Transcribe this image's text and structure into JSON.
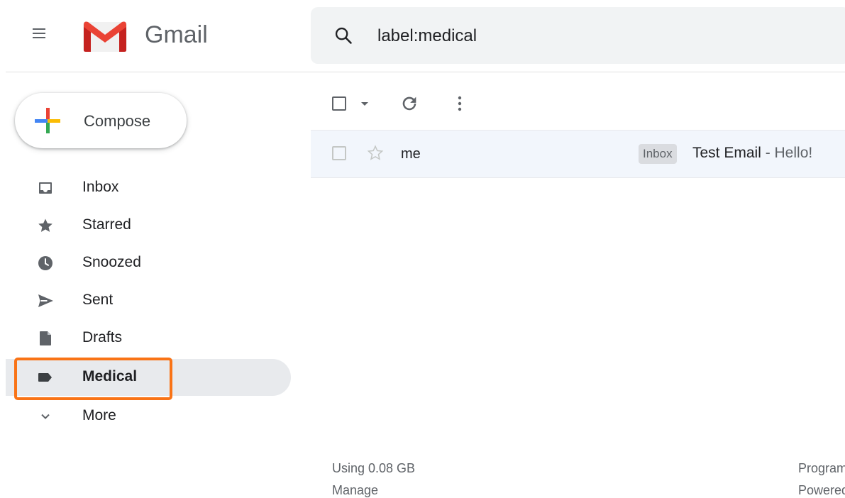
{
  "header": {
    "app_name": "Gmail",
    "search_value": "label:medical"
  },
  "compose": {
    "label": "Compose"
  },
  "sidebar": {
    "items": [
      {
        "label": "Inbox",
        "icon": "inbox-icon"
      },
      {
        "label": "Starred",
        "icon": "star-icon"
      },
      {
        "label": "Snoozed",
        "icon": "clock-icon"
      },
      {
        "label": "Sent",
        "icon": "send-icon"
      },
      {
        "label": "Drafts",
        "icon": "draft-icon"
      },
      {
        "label": "Medical",
        "icon": "label-icon",
        "active": true
      },
      {
        "label": "More",
        "icon": "chevron-down-icon"
      }
    ]
  },
  "toolbar": {
    "icons": [
      "select-checkbox-icon",
      "select-dropdown-icon",
      "refresh-icon",
      "more-options-icon"
    ]
  },
  "messages": [
    {
      "sender": "me",
      "label": "Inbox",
      "subject": "Test Email",
      "snippet": " - Hello!",
      "starred": false
    }
  ],
  "footer": {
    "storage": "Using 0.08 GB",
    "manage": "Manage",
    "program_policies": "Program",
    "powered": "Powered"
  },
  "colors": {
    "accent_highlight": "#f97316",
    "active_nav_bg": "#e8eaed",
    "row_bg": "#f2f6fc"
  }
}
